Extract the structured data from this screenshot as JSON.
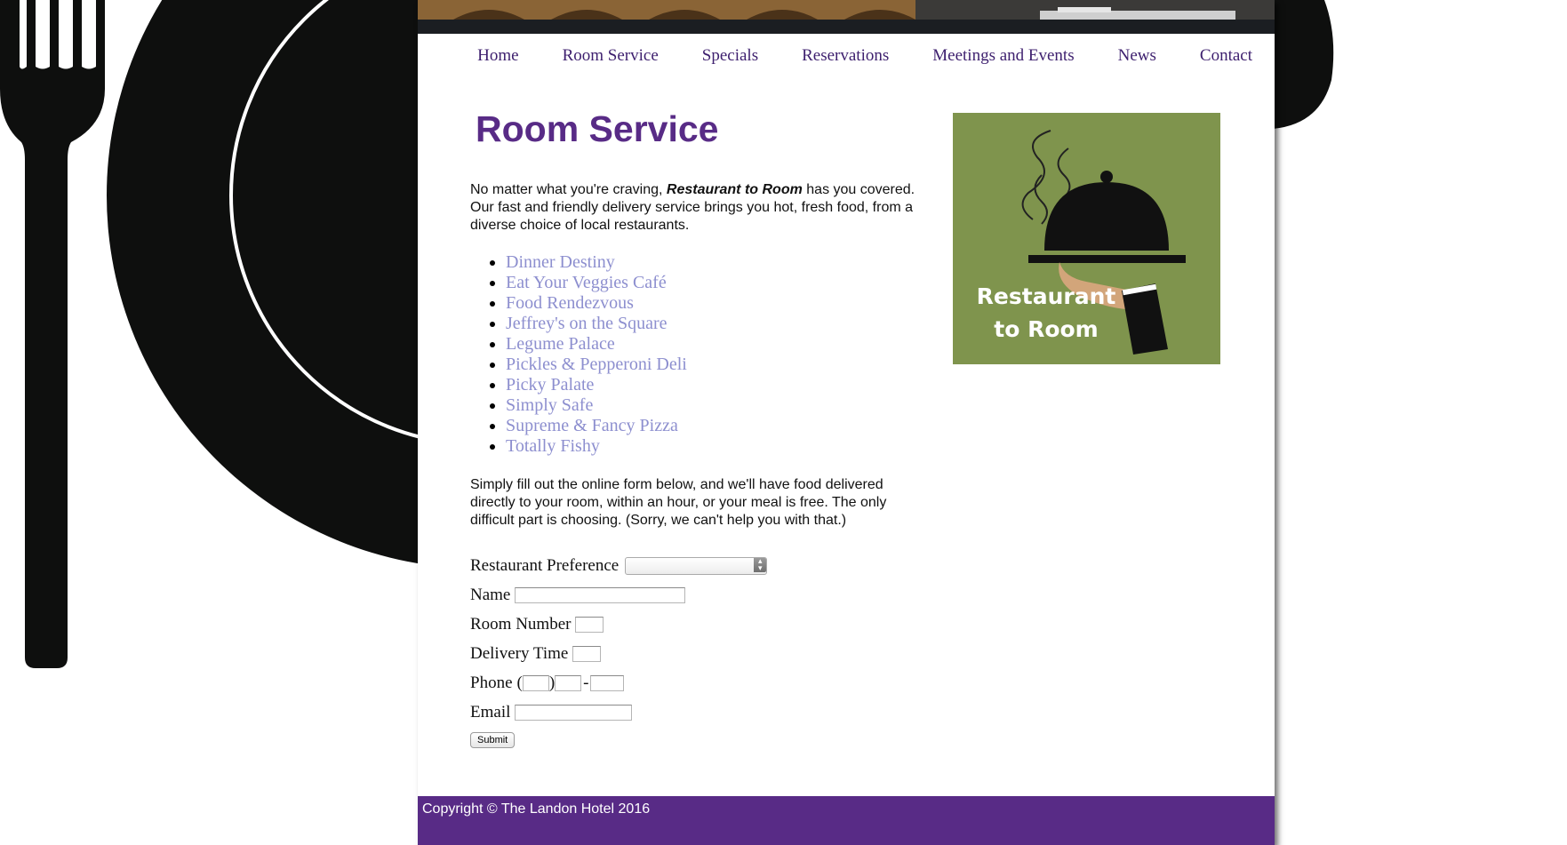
{
  "nav": {
    "items": [
      "Home",
      "Room Service",
      "Specials",
      "Reservations",
      "Meetings and Events",
      "News",
      "Contact"
    ]
  },
  "main": {
    "title": "Room Service",
    "intro": {
      "before": "No matter what you're craving, ",
      "emphasis": "Restaurant to Room",
      "after": " has you covered. Our fast and friendly delivery service brings you hot, fresh food, from a diverse choice of local restaurants."
    },
    "restaurants": [
      "Dinner Destiny",
      "Eat Your Veggies Café",
      "Food Rendezvous",
      "Jeffrey's on the Square",
      "Legume Palace",
      "Pickles & Pepperoni Deli",
      "Picky Palate",
      "Simply Safe",
      "Supreme & Fancy Pizza",
      "Totally Fishy"
    ],
    "instructions": "Simply fill out the online form below, and we'll have food delivered directly to your room, within an hour, or your meal is free. The only difficult part is choosing. (Sorry, we can't help you with that.)"
  },
  "promo": {
    "line1": "Restaurant",
    "line2": "to Room"
  },
  "form": {
    "restaurant_label": "Restaurant Preference",
    "restaurant_value": "",
    "name_label": "Name",
    "room_label": "Room Number",
    "time_label": "Delivery Time",
    "phone_label": "Phone",
    "phone_open": "(",
    "phone_close": ")",
    "phone_dash": "-",
    "email_label": "Email",
    "submit_label": "Submit"
  },
  "footer": {
    "copyright": "Copyright © The Landon Hotel 2016"
  },
  "colors": {
    "brand_purple": "#582b86",
    "nav_text": "#3d1f6e",
    "link": "#8d8fcf",
    "promo_green": "#7f944d"
  },
  "icons": {
    "promo": "cloche-serving-hand-icon",
    "background": "fork-and-plate-illustration"
  }
}
